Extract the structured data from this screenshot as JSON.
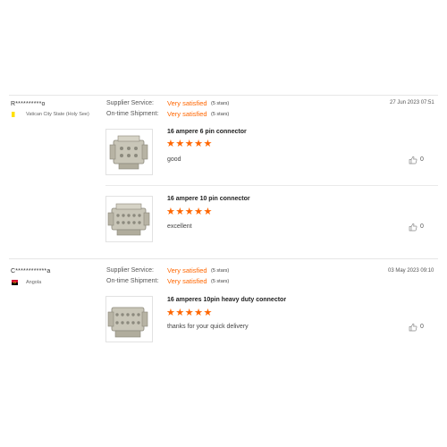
{
  "labels": {
    "supplier_service": "Supplier Service:",
    "ontime_shipment": "On-time Shipment:"
  },
  "reviews": [
    {
      "buyer": "R**********o",
      "country": "Vatican City State (Holy See)",
      "supplier_service": "Very satisfied",
      "supplier_service_note": "(5 stars)",
      "ontime_shipment": "Very satisfied",
      "ontime_shipment_note": "(5 stars)",
      "date": "27 Jun 2023 07:51",
      "products": [
        {
          "name": "16 ampere 6 pin connector",
          "stars": "★★★★★",
          "rating": 5,
          "comment": "good",
          "likes": "0"
        },
        {
          "name": "16 ampere 10 pin connector",
          "stars": "★★★★★",
          "rating": 5,
          "comment": "excellent",
          "likes": "0"
        }
      ]
    },
    {
      "buyer": "C************a",
      "country": "Angola",
      "supplier_service": "Very satisfied",
      "supplier_service_note": "(5 stars)",
      "ontime_shipment": "Very satisfied",
      "ontime_shipment_note": "(5 stars)",
      "date": "03 May 2023 09:10",
      "products": [
        {
          "name": "16 amperes 10pin heavy duty connector",
          "stars": "★★★★★",
          "rating": 5,
          "comment": "thanks for your quick delivery",
          "likes": "0"
        }
      ]
    }
  ],
  "icons": {
    "like": "thumbs-up-icon"
  },
  "colors": {
    "accent": "#ff6600"
  }
}
